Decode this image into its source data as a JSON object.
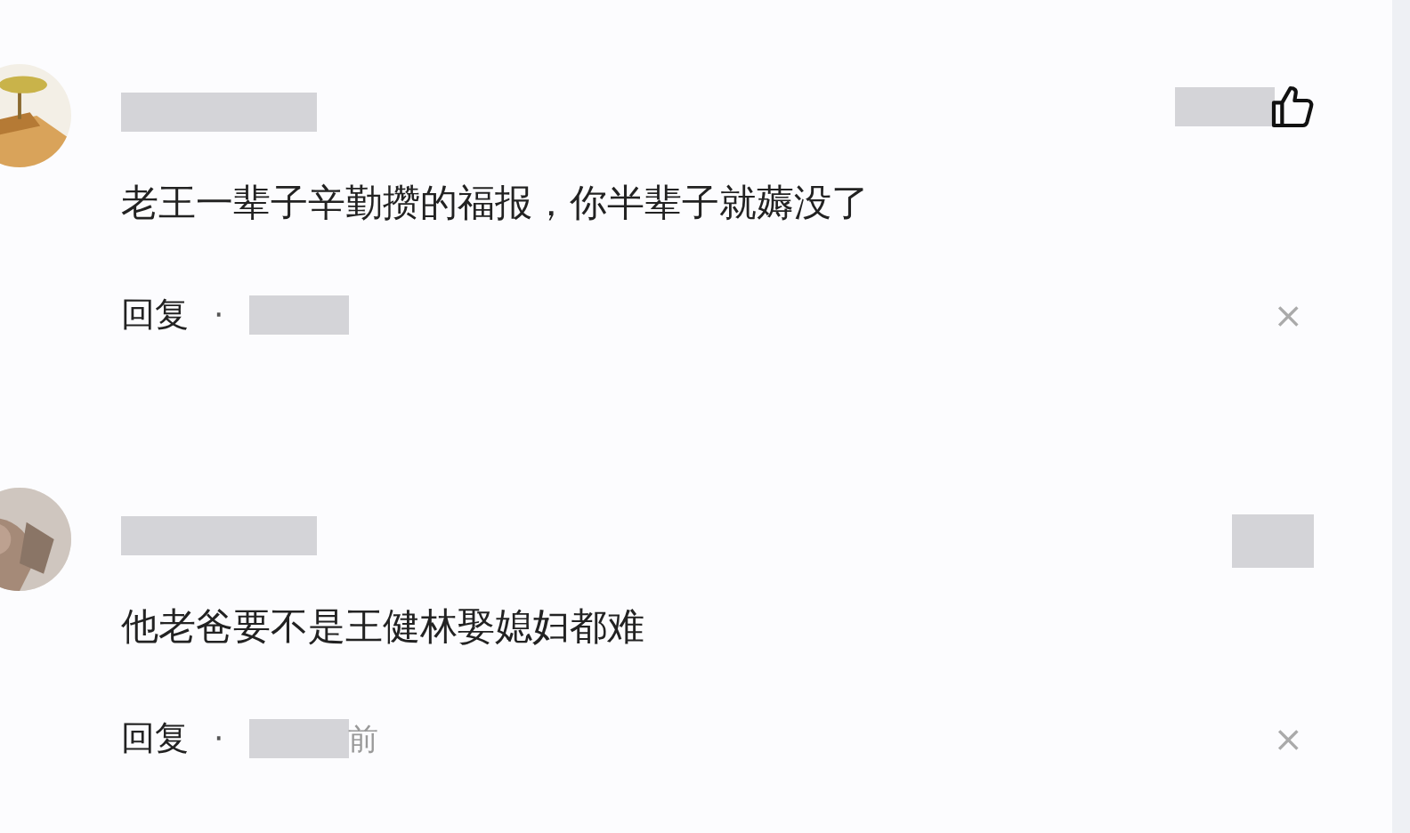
{
  "comments": [
    {
      "text": "老王一辈子辛勤攒的福报，你半辈子就薅没了",
      "reply": "回复",
      "separator": "·",
      "close": "×",
      "likes": true
    },
    {
      "text": "他老爸要不是王健林娶媳妇都难",
      "reply": "回复",
      "separator": "·",
      "time_suffix": "前",
      "close": "×",
      "likes": false
    }
  ]
}
